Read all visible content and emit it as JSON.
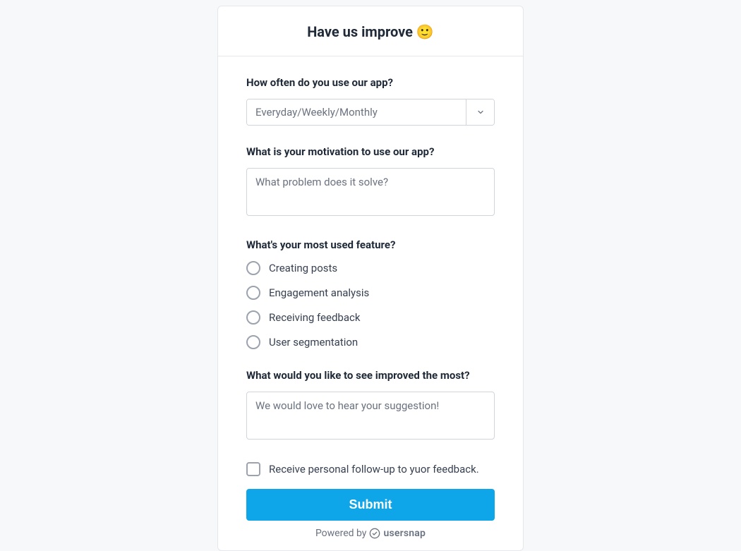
{
  "header": {
    "title": "Have us improve 🙂"
  },
  "q1": {
    "label": "How often do you use our app?",
    "placeholder": "Everyday/Weekly/Monthly"
  },
  "q2": {
    "label": "What is your motivation to use our app?",
    "placeholder": "What problem does it solve?"
  },
  "q3": {
    "label": "What's your most used feature?",
    "options": [
      "Creating posts",
      "Engagement analysis",
      "Receiving feedback",
      "User segmentation"
    ]
  },
  "q4": {
    "label": "What would you like to see improved the most?",
    "placeholder": "We would love to hear your suggestion!"
  },
  "followup": {
    "label": "Receive personal follow-up to yuor feedback."
  },
  "submit": {
    "label": "Submit"
  },
  "footer": {
    "powered": "Powered by",
    "brand": "usersnap"
  }
}
